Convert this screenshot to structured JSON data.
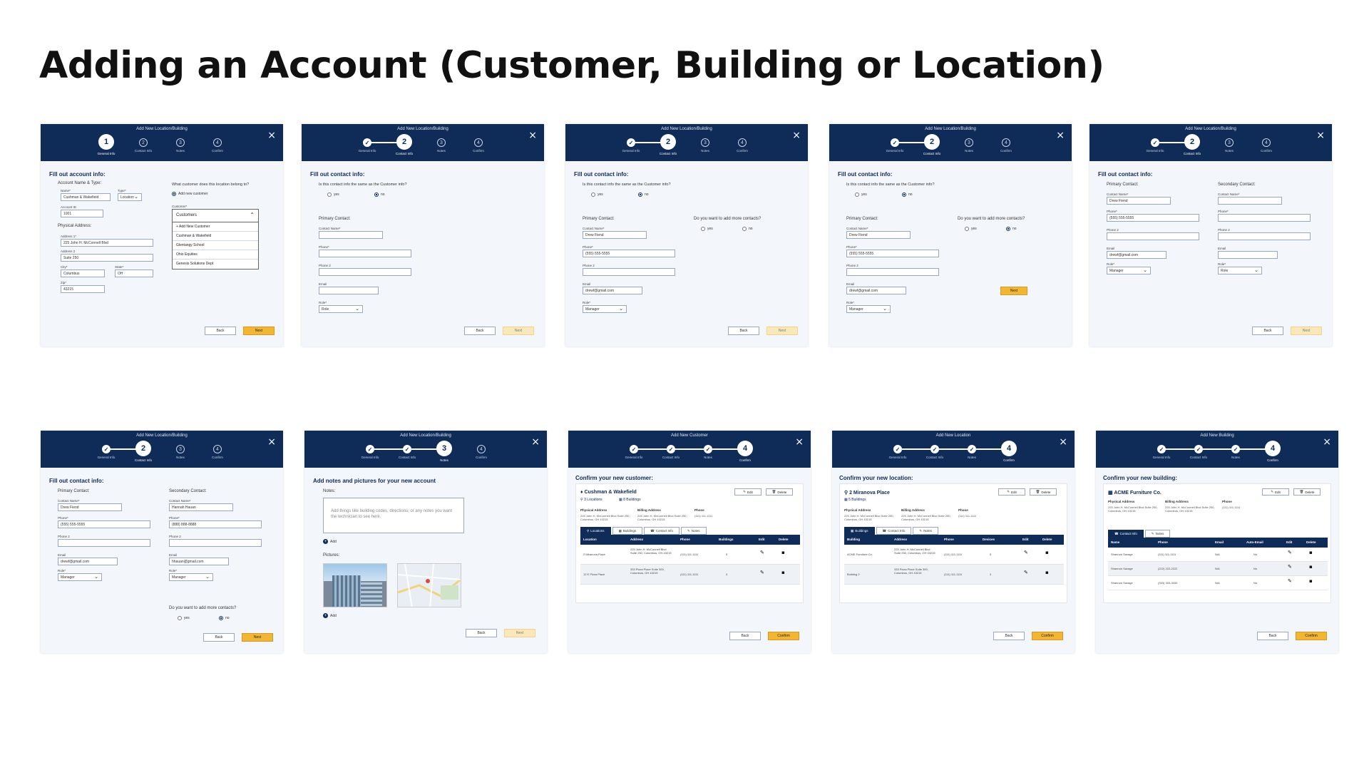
{
  "page": {
    "title": "Adding an Account (Customer, Building or Location)"
  },
  "common": {
    "step_labels": [
      "General Info",
      "Contact Info",
      "Notes",
      "Confirm"
    ],
    "back": "Back",
    "next": "Next",
    "confirm": "Confirm",
    "yes": "yes",
    "no": "no",
    "add": "Add",
    "edit": "Edit",
    "delete": "Delete",
    "close": "×",
    "check": "✓",
    "colors": {
      "header": "#0f2b57",
      "accent": "#f2b632"
    }
  },
  "s1": {
    "header": "Add New Location/Building",
    "section": "Fill out account info:",
    "account_heading": "Account Name & Type:",
    "name_label": "Name*",
    "name_value": "Cushman & Wakefield",
    "type_label": "Type*",
    "type_value": "Location",
    "account_id_label": "Account ID",
    "account_id_value": "1001",
    "physical_heading": "Physical Address:",
    "address1_label": "Address 1*",
    "address1_value": "225 John H. McConnell Blvd",
    "address2_label": "Address 2",
    "address2_value": "Suite 250",
    "city_label": "City*",
    "city_value": "Columbus",
    "state_label": "State*",
    "state_value": "OH",
    "zip_label": "Zip*",
    "zip_value": "43215",
    "customer_q": "What customer does this location belong to?",
    "add_new_customer": "Add new customer",
    "customer_label": "Customer*",
    "dropdown_value": "Customers",
    "dropdown_items": [
      "+ Add New Customer",
      "Cushman & Wakefield",
      "Glentangy School",
      "Ohio Equities",
      "Genesis Solutions Dept"
    ]
  },
  "s2": {
    "header": "Add New Location/Building",
    "section": "Fill out contact info:",
    "same_q": "Is this contact info the same as the Customer info?",
    "primary": "Primary Contact:",
    "contact_name_label": "Contact Name*",
    "phone_label": "Phone*",
    "phone2_label": "Phone 2",
    "email_label": "Email",
    "role_label": "Role*",
    "role_placeholder": "Role"
  },
  "s3": {
    "header": "Add New Location/Building",
    "section": "Fill out contact info:",
    "same_q": "Is this contact info the same as the Customer info?",
    "primary": "Primary Contact:",
    "more_q": "Do you want to add more contacts?",
    "contact_name_label": "Contact Name*",
    "contact_name_value": "Drew Fiend",
    "phone_label": "Phone*",
    "phone_value": "(555) 555-5555",
    "phone2_label": "Phone 2",
    "email_label": "Email",
    "email_value": "drewf@gmail.com",
    "role_label": "Role*",
    "role_value": "Manager"
  },
  "s4": {
    "header": "Add New Location/Building",
    "section": "Fill out contact info:",
    "same_q": "Is this contact info the same as the Customer info?",
    "primary": "Primary Contact:",
    "more_q": "Do you want to add more contacts?",
    "contact_name_label": "Contact Name*",
    "contact_name_value": "Drew Fiend",
    "phone_label": "Phone*",
    "phone_value": "(555) 555-5555",
    "phone2_label": "Phone 2",
    "email_label": "Email",
    "email_value": "drewf@gmail.com",
    "role_label": "Role*",
    "role_value": "Manager"
  },
  "s5": {
    "header": "Add New Location/Building",
    "section": "Fill out contact info:",
    "primary": "Primary Contact:",
    "secondary": "Secondary Contact:",
    "contact_name_label": "Contact Name*",
    "contact_name_value": "Drew Fiend",
    "phone_label": "Phone*",
    "phone_value": "(555) 555-5555",
    "phone2_label": "Phone 2",
    "email_label": "Email",
    "email_value": "drewf@gmail.com",
    "role_label": "Role*",
    "role_value": "Manager",
    "role_placeholder": "Role"
  },
  "s6": {
    "header": "Add New Location/Building",
    "section": "Fill out contact info:",
    "primary": "Primary Contact:",
    "secondary": "Secondary Contact:",
    "more_q": "Do you want to add more contacts?",
    "contact_name_label": "Contact Name*",
    "p_name": "Drew Fiend",
    "s_name": "Hannah Hauan",
    "phone_label": "Phone*",
    "p_phone": "(555) 555-5555",
    "s_phone": "(888) 888-8888",
    "phone2_label": "Phone 2",
    "email_label": "Email",
    "p_email": "drewf@gmail.com",
    "s_email": "hhauan@gmail.com",
    "role_label": "Role*",
    "p_role": "Manager",
    "s_role": "Manager"
  },
  "s7": {
    "header": "Add New Location/Building",
    "section": "Add notes and pictures for your new account",
    "notes_label": "Notes:",
    "notes_placeholder": "Add things like building codes, directions, or any notes you want the technician to see here.",
    "pictures_label": "Pictures:"
  },
  "s8": {
    "header": "Add New Customer",
    "section": "Confirm your new customer:",
    "name": "Cushman & Wakefield",
    "locations": "3 Locations",
    "buildings": "8 Buildings",
    "phys_h": "Physical Address",
    "phys_v": "225 John H. McConnell Blvd Suite 250, Columbus, OH 43215",
    "bill_h": "Billing Address",
    "bill_v": "225 John H. McConnell Blvd Suite 250, Columbus, OH 43215",
    "phone_h": "Phone",
    "phone_v": "(111) 111-1111",
    "tabs": [
      "Locations",
      "Buildings",
      "Contact Info",
      "Notes"
    ],
    "cols": [
      "Location",
      "Address",
      "Phone",
      "Buildings",
      "Edit",
      "Delete"
    ],
    "rows": [
      {
        "c1": "2 Miranova Place",
        "c2": "225 John H. McConnell Blvd Suite 250, Columbus, OH 43215",
        "c3": "(111) 111-1111",
        "c4": "5"
      },
      {
        "c1": "12 E Pizza Place",
        "c2": "333 Pizza Place Suite 300, Columbus, OH 43215",
        "c3": "(111) 111-1111",
        "c4": "3"
      }
    ]
  },
  "s9": {
    "header": "Add New Location",
    "section": "Confirm your new location:",
    "name": "2 Miranova Place",
    "buildings": "5 Buildings",
    "phys_h": "Physical Address",
    "phys_v": "225 John H. McConnell Blvd Suite 250, Columbus, OH 43215",
    "bill_h": "Billing Address",
    "bill_v": "225 John H. McConnell Blvd Suite 250, Columbus, OH 43215",
    "phone_h": "Phone",
    "phone_v": "(111) 111-1111",
    "tabs": [
      "Buildings",
      "Contact Info",
      "Notes"
    ],
    "cols": [
      "Building",
      "Address",
      "Phone",
      "Devices",
      "Edit",
      "Delete"
    ],
    "rows": [
      {
        "c1": "ACME Furniture Co.",
        "c2": "225 John H. McConnell Blvd Suite 250, Columbus, OH 43215",
        "c3": "(111) 111-1111",
        "c4": "5"
      },
      {
        "c1": "Building 2",
        "c2": "333 Pizza Place Suite 300, Columbus, OH 43215",
        "c3": "(111) 111-1111",
        "c4": "3"
      }
    ]
  },
  "s10": {
    "header": "Add New Building",
    "section": "Confirm your new building:",
    "name": "ACME Furniture Co.",
    "phys_h": "Physical Address",
    "phys_v": "225 John H. McConnell Blvd Suite 250, Columbus, OH 43215",
    "bill_h": "Billing Address",
    "bill_v": "225 John H. McConnell Blvd Suite 250, Columbus, OH 43215",
    "phone_h": "Phone",
    "phone_v": "(111) 111-1111",
    "tabs": [
      "Contact Info",
      "Notes"
    ],
    "cols": [
      "Name",
      "Phone",
      "Email",
      "Auto-Email",
      "Edit",
      "Delete"
    ],
    "rows": [
      {
        "c1": "Shannon Savage",
        "c2": "(111) 111-1111",
        "c3": "N/A",
        "c4": "No"
      },
      {
        "c1": "Shannon Savage",
        "c2": "(222) 222-2222",
        "c3": "N/A",
        "c4": "No"
      },
      {
        "c1": "Shannon Savage",
        "c2": "(333) 333-3333",
        "c3": "N/A",
        "c4": "No"
      }
    ]
  }
}
